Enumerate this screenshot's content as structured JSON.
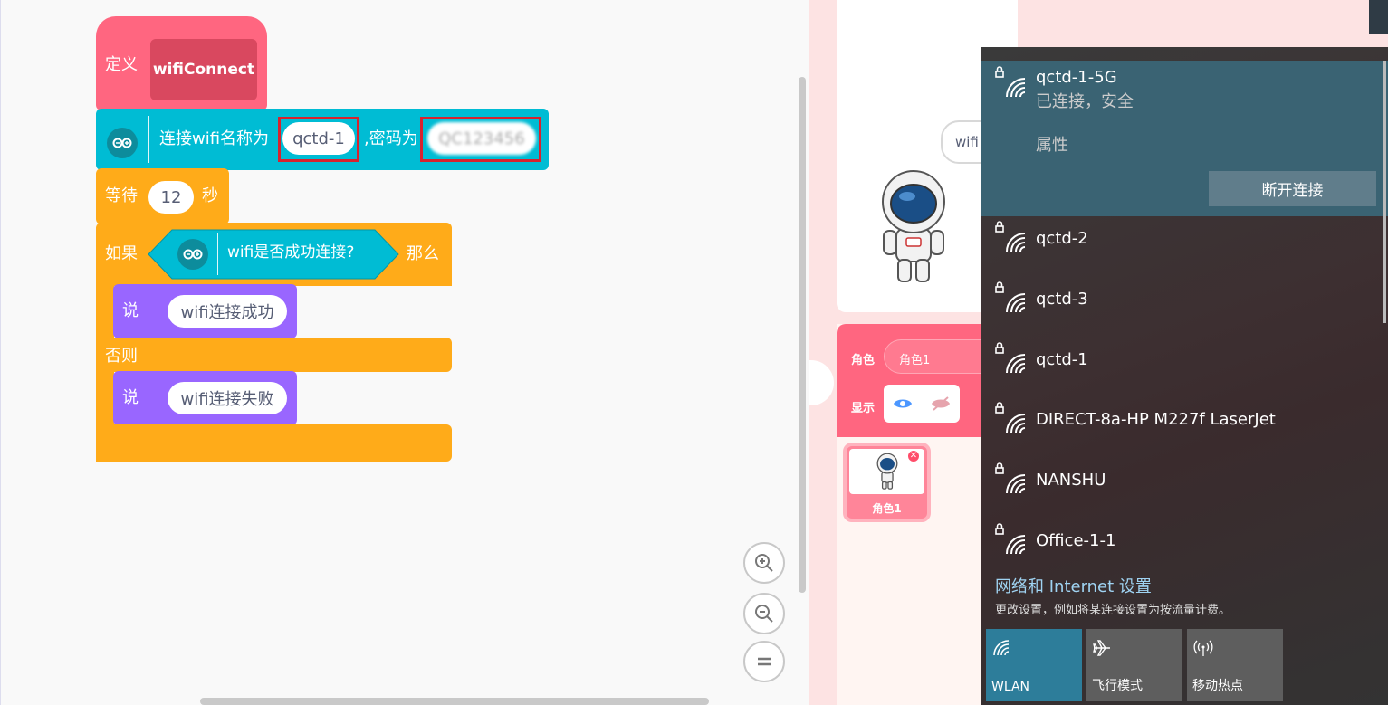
{
  "blocks": {
    "define_label": "定义",
    "define_name": "wifiConnect",
    "connect_text1": "连接wifi名称为",
    "ssid_value": "qctd-1",
    "connect_text2": ",密码为",
    "password_value": "QC123456",
    "wait_text1": "等待",
    "wait_value": "12",
    "wait_text2": "秒",
    "if_label": "如果",
    "if_condition": "wifi是否成功连接?",
    "then_label": "那么",
    "say1_label": "说",
    "say1_value": "wifi连接成功",
    "else_label": "否则",
    "say2_label": "说",
    "say2_value": "wifi连接失败"
  },
  "stage": {
    "bubble_text": "wifi"
  },
  "sprite_panel": {
    "role_label": "角色",
    "role_value": "角色1",
    "show_label": "显示",
    "sprite_name": "角色1"
  },
  "wifi_flyout": {
    "connected": {
      "ssid": "qctd-1-5G",
      "status": "已连接，安全",
      "properties": "属性",
      "disconnect": "断开连接"
    },
    "networks": [
      "qctd-2",
      "qctd-3",
      "qctd-1",
      "DIRECT-8a-HP M227f LaserJet",
      "NANSHU",
      "Office-1-1"
    ],
    "settings_link": "网络和 Internet 设置",
    "settings_desc": "更改设置，例如将某连接设置为按流量计费。",
    "tiles": [
      {
        "label": "WLAN",
        "icon": "wifi-icon"
      },
      {
        "label": "飞行模式",
        "icon": "airplane-icon"
      },
      {
        "label": "移动热点",
        "icon": "hotspot-icon"
      }
    ]
  },
  "colors": {
    "define_block": "#ff6680",
    "arduino_block": "#00bcd4",
    "control_block": "#ffab19",
    "looks_block": "#9966ff",
    "flyout_selected": "#3a6373",
    "tile_active": "#2d7d9a"
  }
}
